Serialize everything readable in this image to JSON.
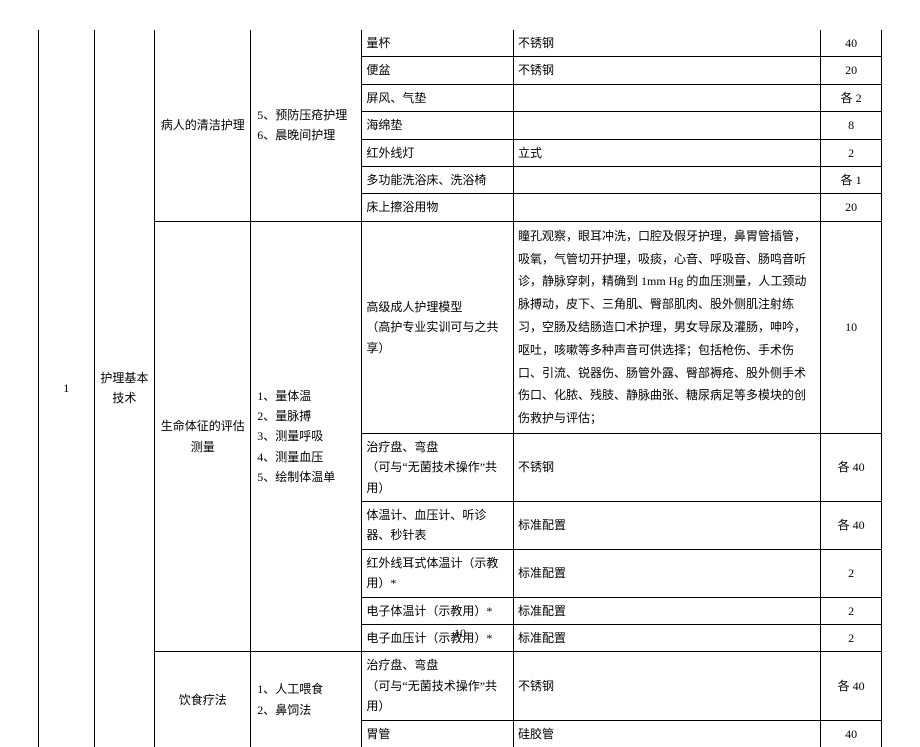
{
  "pagenum": "10",
  "col1": "1",
  "col2": "护理基本技术",
  "sections": {
    "s1": {
      "c3": "病人的清洁护理",
      "c4": "5、预防压疮护理\n6、晨晚间护理"
    },
    "s2": {
      "c3": "生命体征的评估测量",
      "c4": "1、量体温\n2、量脉搏\n3、测量呼吸\n4、测量血压\n5、绘制体温单"
    },
    "s3": {
      "c3": "饮食疗法",
      "c4": "1、人工喂食\n2、鼻饲法"
    }
  },
  "rows": [
    {
      "item": "量杯",
      "desc": "不锈钢",
      "qty": "40"
    },
    {
      "item": "便盆",
      "desc": "不锈钢",
      "qty": "20"
    },
    {
      "item": "屏风、气垫",
      "desc": "",
      "qty": "各 2"
    },
    {
      "item": "海绵垫",
      "desc": "",
      "qty": "8"
    },
    {
      "item": "红外线灯",
      "desc": "立式",
      "qty": "2"
    },
    {
      "item": "多功能洗浴床、洗浴椅",
      "desc": "",
      "qty": "各 1"
    },
    {
      "item": "床上擦浴用物",
      "desc": "",
      "qty": "20"
    },
    {
      "item": "高级成人护理模型\n（高护专业实训可与之共享）",
      "desc": "瞳孔观察，眼耳冲洗，口腔及假牙护理，鼻胃管插管，吸氧，气管切开护理，吸痰，心音、呼吸音、肠鸣音听诊，静脉穿刺，精确到 1mm Hg 的血压测量，人工颈动脉搏动，皮下、三角肌、臀部肌肉、股外侧肌注射练习，空肠及结肠造口术护理，男女导尿及灌肠，呻吟，呕吐，咳嗽等多种声音可供选择；包括枪伤、手术伤口、引流、锐器伤、肠管外露、臀部褥疮、股外侧手术伤口、化脓、残肢、静脉曲张、糖尿病足等多模块的创伤救护与评估；",
      "qty": "10"
    },
    {
      "item": "治疗盘、弯盘\n（可与“无菌技术操作”共用）",
      "desc": "不锈钢",
      "qty": "各 40"
    },
    {
      "item": "体温计、血压计、听诊器、秒针表",
      "desc": "标准配置",
      "qty": "各 40"
    },
    {
      "item": "红外线耳式体温计（示教用）*",
      "desc": "标准配置",
      "qty": "2"
    },
    {
      "item": "电子体温计（示教用）*",
      "desc": "标准配置",
      "qty": "2"
    },
    {
      "item": "电子血压计（示教用）*",
      "desc": "标准配置",
      "qty": "2"
    },
    {
      "item": "治疗盘、弯盘\n（可与“无菌技术操作”共用）",
      "desc": "不锈钢",
      "qty": "各 40"
    },
    {
      "item": "胃管",
      "desc": "硅胶管",
      "qty": "40"
    }
  ]
}
